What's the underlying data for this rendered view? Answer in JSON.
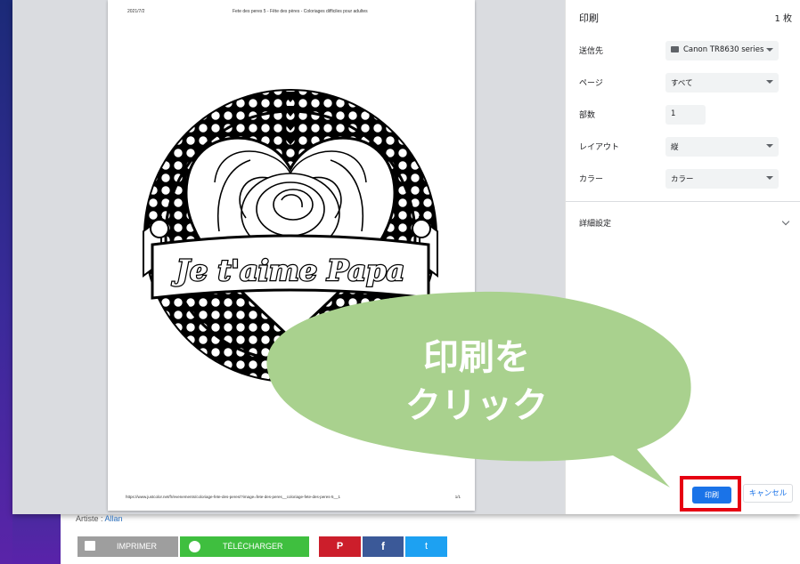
{
  "preview": {
    "header_date": "2021/7/2",
    "header_title": "Fete des peres 5 - Fête des pères - Coloriages difficiles pour adultes",
    "banner_text": "Je t'aime Papa",
    "footer_url": "https://www.justcolor.net/fr/evenements/coloriage-fete-des-peres/?image=fete-des-peres__coloriage-fete-des-peres-5__1",
    "footer_page": "1/1"
  },
  "settings": {
    "title": "印刷",
    "sheet_count": "1 枚",
    "destination": {
      "label": "送信先",
      "value": "Canon TR8630 series"
    },
    "pages": {
      "label": "ページ",
      "value": "すべて"
    },
    "copies": {
      "label": "部数",
      "value": "1"
    },
    "layout": {
      "label": "レイアウト",
      "value": "縦"
    },
    "color": {
      "label": "カラー",
      "value": "カラー"
    },
    "advanced": "詳細設定",
    "print_button": "印刷",
    "cancel_button": "キャンセル"
  },
  "callout": {
    "line1": "印刷を",
    "line2": "クリック",
    "fill_color": "#a9d18e",
    "highlight_color": "#e60012"
  },
  "page": {
    "artist_label": "Artiste :",
    "artist_name": "Allan",
    "buttons": {
      "print": "IMPRIMER",
      "download": "TÉLÉCHARGER",
      "pinterest": "P",
      "facebook": "f",
      "twitter": "t"
    }
  }
}
